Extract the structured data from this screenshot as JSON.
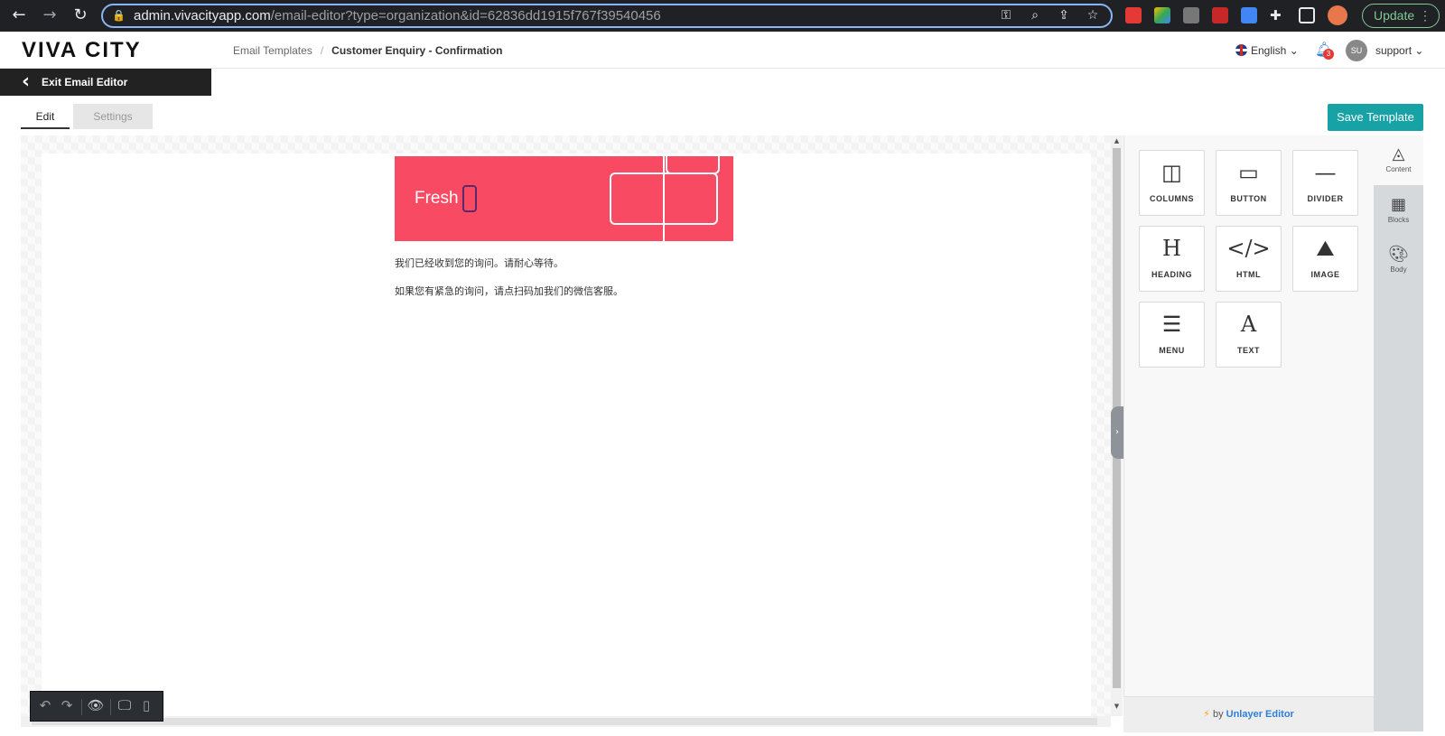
{
  "browser": {
    "url_host": "admin.vivacityapp.com",
    "url_path": "/email-editor?type=organization&id=62836dd1915f767f39540456",
    "update_label": "Update"
  },
  "header": {
    "logo": "VIVA CITY",
    "breadcrumb": [
      "Email Templates",
      "/",
      "Customer Enquiry - Confirmation"
    ],
    "language": "English",
    "notification_count": "3",
    "avatar_initials": "SU",
    "username": "support"
  },
  "exit_label": "Exit Email Editor",
  "tabs": {
    "edit": "Edit",
    "settings": "Settings"
  },
  "save_label": "Save Template",
  "email": {
    "banner_text": "Fresh",
    "paragraphs": [
      "我们已经收到您的询问。请耐心等待。",
      "如果您有紧急的询问，请点扫码加我们的微信客服。"
    ]
  },
  "content_tools": [
    {
      "label": "COLUMNS",
      "icon": "columns-icon"
    },
    {
      "label": "BUTTON",
      "icon": "button-icon"
    },
    {
      "label": "DIVIDER",
      "icon": "divider-icon"
    },
    {
      "label": "HEADING",
      "icon": "heading-icon"
    },
    {
      "label": "HTML",
      "icon": "code-icon"
    },
    {
      "label": "IMAGE",
      "icon": "image-icon"
    },
    {
      "label": "MENU",
      "icon": "menu-icon"
    },
    {
      "label": "TEXT",
      "icon": "text-icon"
    }
  ],
  "side_tabs": [
    "Content",
    "Blocks",
    "Body"
  ],
  "footer": {
    "by": "by",
    "brand": "Unlayer Editor"
  },
  "colors": {
    "accent": "#17a2a6",
    "banner": "#f84a63",
    "dark": "#222222"
  }
}
